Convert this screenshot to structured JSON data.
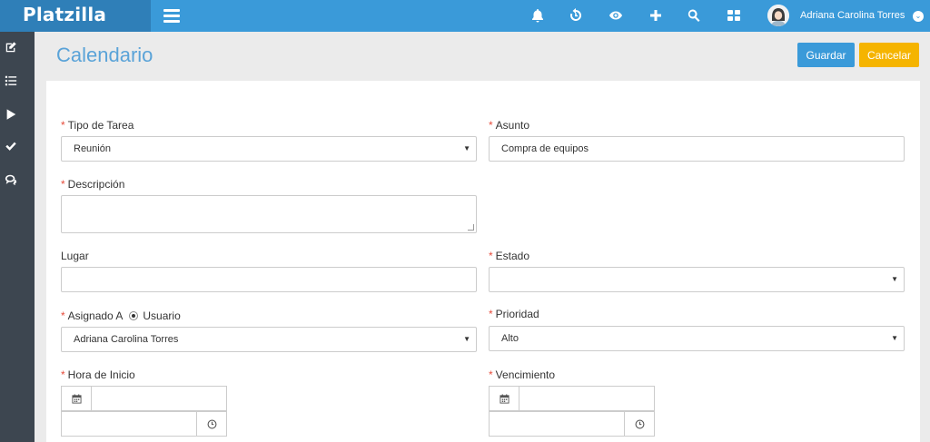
{
  "app": {
    "brand": "Platzilla"
  },
  "topbar": {
    "icons": [
      "bell-icon",
      "history-icon",
      "eye-icon",
      "plus-icon",
      "search-icon",
      "grid-icon"
    ],
    "user_name": "Adriana Carolina Torres"
  },
  "sidebar": {
    "icons": [
      "edit-icon",
      "list-icon",
      "play-icon",
      "check-icon",
      "chat-icon"
    ]
  },
  "page": {
    "title": "Calendario",
    "save_label": "Guardar",
    "cancel_label": "Cancelar"
  },
  "form": {
    "required_mark": "*",
    "tipo_tarea": {
      "label": "Tipo de Tarea",
      "value": "Reunión"
    },
    "asunto": {
      "label": "Asunto",
      "value": "Compra de equipos"
    },
    "descripcion": {
      "label": "Descripción",
      "value": ""
    },
    "lugar": {
      "label": "Lugar",
      "value": ""
    },
    "estado": {
      "label": "Estado",
      "value": ""
    },
    "asignado": {
      "label": "Asignado A",
      "radio_label": "Usuario",
      "value": "Adriana Carolina Torres"
    },
    "prioridad": {
      "label": "Prioridad",
      "value": "Alto"
    },
    "hora_inicio": {
      "label": "Hora de Inicio",
      "date": "",
      "time": ""
    },
    "vencimiento": {
      "label": "Vencimiento",
      "date": "",
      "time": ""
    },
    "caret": "▼"
  }
}
